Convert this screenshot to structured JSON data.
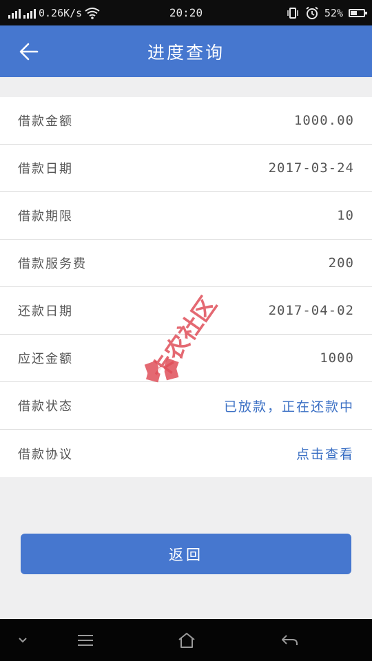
{
  "status_bar": {
    "network_speed": "0.26K/s",
    "time": "20:20",
    "battery": "52%",
    "battery_level": 0.52
  },
  "header": {
    "title": "进度查询"
  },
  "details": [
    {
      "label": "借款金额",
      "value": "1000.00",
      "link": false
    },
    {
      "label": "借款日期",
      "value": "2017-03-24",
      "link": false
    },
    {
      "label": "借款期限",
      "value": "10",
      "link": false
    },
    {
      "label": "借款服务费",
      "value": "200",
      "link": false
    },
    {
      "label": "还款日期",
      "value": "2017-04-02",
      "link": false
    },
    {
      "label": "应还金额",
      "value": "1000",
      "link": false
    },
    {
      "label": "借款状态",
      "value": "已放款，正在还款中",
      "link": true
    },
    {
      "label": "借款协议",
      "value": "点击查看",
      "link": true
    }
  ],
  "return_button": {
    "label": "返回"
  },
  "watermark": {
    "text": "卡农社区"
  },
  "colors": {
    "primary": "#4677cf",
    "link": "#3a6fc4",
    "watermark": "#e0505a"
  }
}
